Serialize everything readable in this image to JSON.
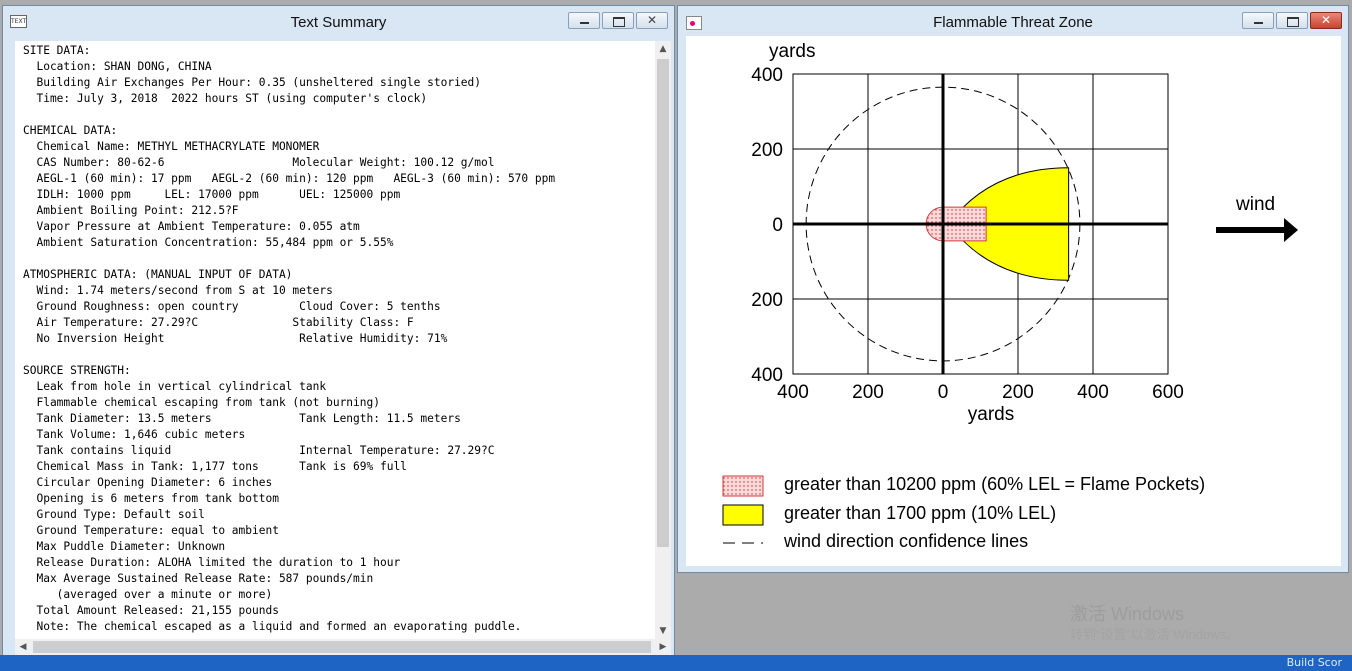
{
  "left_window": {
    "title": "Text Summary",
    "icon_text": "TEXT",
    "close_glyph": "✕",
    "lines": [
      "SITE DATA:",
      "  Location: SHAN DONG, CHINA",
      "  Building Air Exchanges Per Hour: 0.35 (unsheltered single storied)",
      "  Time: July 3, 2018  2022 hours ST (using computer's clock)",
      "",
      "CHEMICAL DATA:",
      "  Chemical Name: METHYL METHACRYLATE MONOMER",
      "  CAS Number: 80-62-6                   Molecular Weight: 100.12 g/mol",
      "  AEGL-1 (60 min): 17 ppm   AEGL-2 (60 min): 120 ppm   AEGL-3 (60 min): 570 ppm",
      "  IDLH: 1000 ppm     LEL: 17000 ppm      UEL: 125000 ppm",
      "  Ambient Boiling Point: 212.5?F",
      "  Vapor Pressure at Ambient Temperature: 0.055 atm",
      "  Ambient Saturation Concentration: 55,484 ppm or 5.55%",
      "",
      "ATMOSPHERIC DATA: (MANUAL INPUT OF DATA)",
      "  Wind: 1.74 meters/second from S at 10 meters",
      "  Ground Roughness: open country         Cloud Cover: 5 tenths",
      "  Air Temperature: 27.29?C              Stability Class: F",
      "  No Inversion Height                    Relative Humidity: 71%",
      "",
      "SOURCE STRENGTH:",
      "  Leak from hole in vertical cylindrical tank",
      "  Flammable chemical escaping from tank (not burning)",
      "  Tank Diameter: 13.5 meters             Tank Length: 11.5 meters",
      "  Tank Volume: 1,646 cubic meters",
      "  Tank contains liquid                   Internal Temperature: 27.29?C",
      "  Chemical Mass in Tank: 1,177 tons      Tank is 69% full",
      "  Circular Opening Diameter: 6 inches",
      "  Opening is 6 meters from tank bottom",
      "  Ground Type: Default soil",
      "  Ground Temperature: equal to ambient",
      "  Max Puddle Diameter: Unknown",
      "  Release Duration: ALOHA limited the duration to 1 hour",
      "  Max Average Sustained Release Rate: 587 pounds/min",
      "     (averaged over a minute or more)",
      "  Total Amount Released: 21,155 pounds",
      "  Note: The chemical escaped as a liquid and formed an evaporating puddle."
    ],
    "scroll_up": "▲",
    "scroll_down": "▼",
    "scroll_left": "◀",
    "scroll_right": "▶"
  },
  "right_window": {
    "title": "Flammable Threat Zone",
    "close_glyph": "✕",
    "wind_label": "wind",
    "legend": [
      "greater than 10200 ppm (60% LEL = Flame Pockets)",
      "greater than 1700 ppm (10% LEL)",
      "wind direction confidence lines"
    ],
    "colors": {
      "flame_pocket_fill": "#f9d9d9",
      "flame_pocket_stroke": "#d23b3b",
      "lel10_fill": "#ffff00"
    }
  },
  "chart_data": {
    "type": "area",
    "ylabel": "yards",
    "xlabel": "yards",
    "x_ticks": [
      "400",
      "200",
      "0",
      "200",
      "400",
      "600"
    ],
    "y_ticks": [
      "400",
      "200",
      "0",
      "200",
      "400"
    ],
    "x_tick_values": [
      -400,
      -200,
      0,
      200,
      400,
      600
    ],
    "y_tick_values": [
      400,
      200,
      0,
      -200,
      -400
    ],
    "xlim": [
      -400,
      600
    ],
    "ylim": [
      -400,
      400
    ],
    "grid": true,
    "confidence_circle_radius": 365,
    "zones": [
      {
        "name": "greater than 1700 ppm (10% LEL)",
        "x_max": 335,
        "half_width": 150,
        "x_origin": 15
      },
      {
        "name": "greater than 10200 ppm (60% LEL = Flame Pockets)",
        "x_max": 115,
        "half_width": 45,
        "x_origin": -45
      }
    ]
  },
  "watermark": {
    "line1": "激活 Windows",
    "line2": "转到“设置”以激活 Windows。"
  },
  "taskbar_text": "Build Scor"
}
